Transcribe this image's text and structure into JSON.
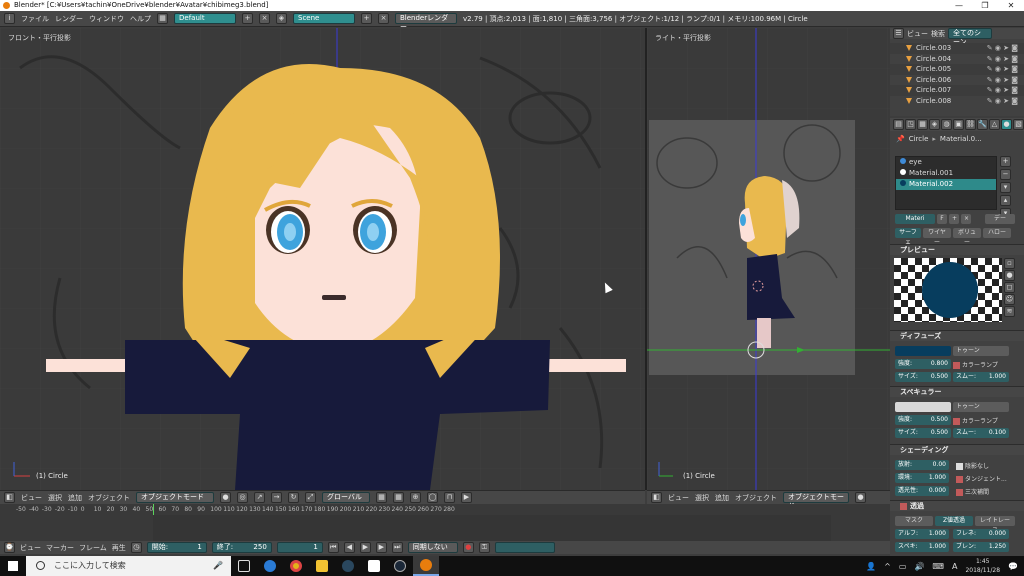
{
  "window": {
    "title": "Blender* [C:¥Users¥tachin¥OneDrive¥blender¥Avatar¥chibimeg3.blend]",
    "buttons": [
      "—",
      "❐",
      "✕"
    ]
  },
  "menubar": {
    "items": [
      "ファイル",
      "レンダー",
      "ウィンドウ",
      "ヘルプ"
    ],
    "layout": "Default",
    "scene": "Scene",
    "engine": "Blenderレンダー",
    "stats": "v2.79 | 頂点:2,013 | 面:1,810 | 三角面:3,756 | オブジェクト:1/12 | ランプ:0/1 | メモリ:100.96M | Circle"
  },
  "viewport_left": {
    "label": "フロント・平行投影",
    "object": "(1) Circle"
  },
  "viewport_right": {
    "label": "ライト・平行投影",
    "object": "(1) Circle"
  },
  "header_left": {
    "items": [
      "ビュー",
      "選択",
      "追加",
      "オブジェクト"
    ],
    "mode": "オブジェクトモード",
    "orientation": "グローバル"
  },
  "header_right": {
    "items": [
      "ビュー",
      "選択",
      "追加",
      "オブジェクト"
    ],
    "mode": "オブジェクトモード"
  },
  "timeline": {
    "ticks": [
      "-50",
      "-40",
      "-30",
      "-20",
      "-10",
      "0",
      "10",
      "20",
      "30",
      "40",
      "50",
      "60",
      "70",
      "80",
      "90",
      "100",
      "110",
      "120",
      "130",
      "140",
      "150",
      "160",
      "170",
      "180",
      "190",
      "200",
      "210",
      "220",
      "230",
      "240",
      "250",
      "260",
      "270",
      "280"
    ]
  },
  "timeline_bar": {
    "items": [
      "ビュー",
      "マーカー",
      "フレーム",
      "再生"
    ],
    "start_label": "開始:",
    "start_value": "1",
    "end_label": "終了:",
    "end_value": "250",
    "current": "1",
    "sync": "同期しない"
  },
  "outliner": {
    "tabs": [
      "ビュー",
      "検索",
      "全てのシーン"
    ],
    "rows": [
      "Circle.003",
      "Circle.004",
      "Circle.005",
      "Circle.006",
      "Circle.007",
      "Circle.008"
    ]
  },
  "properties": {
    "breadcrumb": [
      "Circle",
      "Material.0..."
    ],
    "materials": [
      "eye",
      "Material.001",
      "Material.002"
    ],
    "material_field": "Materi",
    "material_f": "F",
    "material_data": "デー",
    "type_tabs": [
      "サーフェ",
      "ワイヤー",
      "ボリュー",
      "ハロー"
    ],
    "preview_title": "プレビュー",
    "diffuse": {
      "title": "ディフューズ",
      "shader": "トゥーン",
      "intensity_label": "強度:",
      "intensity": "0.800",
      "ramp": "カラーランプ",
      "size_label": "サイズ:",
      "size": "0.500",
      "smooth_label": "スムー:",
      "smooth": "1.000",
      "color": "#073d5e"
    },
    "specular": {
      "title": "スペキュラー",
      "shader": "トゥーン",
      "intensity_label": "強度:",
      "intensity": "0.500",
      "ramp": "カラーランプ",
      "size_label": "サイズ:",
      "size": "0.500",
      "smooth_label": "スムー:",
      "smooth": "0.100"
    },
    "shading": {
      "title": "シェーディング",
      "emit_label": "放射:",
      "emit": "0.00",
      "shadeless": "陰影なし",
      "ambient_label": "環境:",
      "ambient": "1.000",
      "tangent": "タンジェント...",
      "translucency_label": "透光性:",
      "translucency": "0.000",
      "cubic": "三次補間"
    },
    "transparency": {
      "title": "透過",
      "tabs": [
        "マスク",
        "Z値透過",
        "レイトレース"
      ],
      "alpha_label": "アルフ:",
      "alpha": "1.000",
      "fresnel_label": "フレネ:",
      "fresnel": "0.000",
      "spec_label": "スペキ:",
      "spec": "1.000",
      "blend_label": "ブレン:",
      "blend": "1.250"
    }
  },
  "taskbar": {
    "search": "ここに入力して検索",
    "time": "1:45",
    "date": "2018/11/28",
    "lang": "A"
  },
  "colors": {
    "hair": "#e9b94e",
    "skin": "#fce1d8",
    "dress": "#171a3b",
    "eye": "#3ea3dd"
  }
}
